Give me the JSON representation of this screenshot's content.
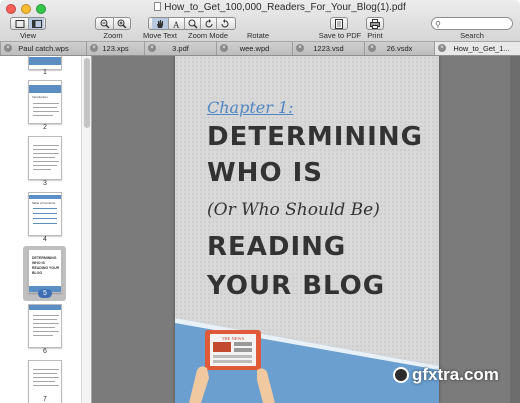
{
  "window": {
    "title": "How_to_Get_100,000_Readers_For_Your_Blog(1).pdf"
  },
  "toolbar": {
    "view_label": "View",
    "zoom_label": "Zoom",
    "move_text_label": "Move Text",
    "zoom_mode_label": "Zoom Mode",
    "rotate_label": "Rotate",
    "save_pdf_label": "Save to PDF",
    "print_label": "Print",
    "search_label": "Search"
  },
  "tabs": [
    {
      "label": "Paul catch.wps"
    },
    {
      "label": "123.xps"
    },
    {
      "label": "3.pdf"
    },
    {
      "label": "wee.wpd"
    },
    {
      "label": "1223.vsd"
    },
    {
      "label": "26.vsdx"
    },
    {
      "label": "How_to_Get_1..."
    }
  ],
  "sidebar": {
    "pages": [
      "1",
      "2",
      "3",
      "4",
      "5",
      "6",
      "7"
    ],
    "selected_page": "5",
    "thumb_texts": {
      "page2": "Introduction",
      "page4": "Table of Contents",
      "page5": "DETERMINING WHO IS READING YOUR BLOG"
    }
  },
  "page": {
    "chapter": "Chapter 1:",
    "line1": "DETERMINING",
    "line2": "WHO IS",
    "line3": "(Or Who Should Be)",
    "line4": "READING",
    "line5": "YOUR BLOG",
    "tablet_text": "THE NEWS"
  },
  "watermark": {
    "text": "gfxtra.com"
  },
  "colors": {
    "accent_blue": "#4f86c4",
    "page_bg": "#d8d8d8",
    "heading_text": "#333333",
    "main_bg": "#7b7b7b"
  }
}
